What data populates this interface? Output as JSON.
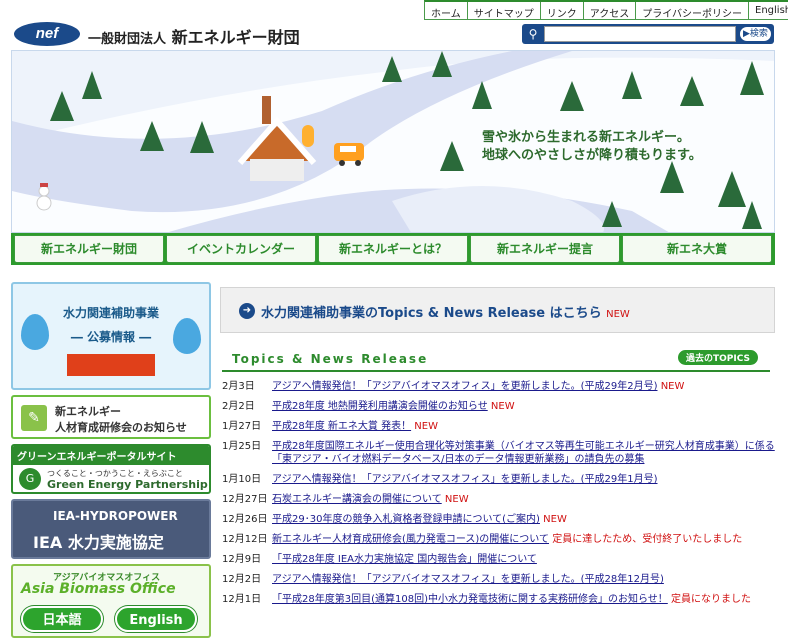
{
  "topnav": [
    "ホーム",
    "サイトマップ",
    "リンク",
    "アクセス",
    "プライバシーポリシー",
    "English"
  ],
  "logo": "nef",
  "org_prefix": "一般財団法人",
  "org_name": "新エネルギー財団",
  "search": {
    "placeholder": "",
    "button": "検索"
  },
  "hero": {
    "slogan1": "雪や氷から生まれる新エネルギー。",
    "slogan2": "地球へのやさしさが降り積もります。"
  },
  "mainnav": [
    "新エネルギー財団",
    "イベントカレンダー",
    "新エネルギーとは？",
    "新エネルギー提言",
    "新エネ大賞"
  ],
  "sidebar": {
    "hydro_title": "水力関連補助事業",
    "hydro_sub": "― 公募情報 ―",
    "training1": "新エネルギー",
    "training2": "人材育成研修会のお知らせ",
    "green_head": "グリーンエネルギーポータルサイト",
    "green_sub": "つくること・つかうこと・えらぶこと",
    "green_name": "Green Energy Partnership",
    "iea_a": "IEA-HYDROPOWER",
    "iea_b": "IEA 水力実施協定",
    "abo_a": "アジアバイオマスオフィス",
    "abo_b": "Asia Biomass Office",
    "abo_jp": "日本語",
    "abo_en": "English"
  },
  "banner": {
    "text": "水力関連補助事業のTopics & News Release はこちら",
    "new": "NEW"
  },
  "topics": {
    "title": "Topics & News Release",
    "past": "過去のTOPICS"
  },
  "news": [
    {
      "date": "2月3日",
      "text": "アジアへ情報発信！「アジアバイオマスオフィス」を更新しました。(平成29年2月号)",
      "new": "NEW",
      "extra": ""
    },
    {
      "date": "2月2日",
      "text": "平成28年度 地熱開発利用講演会開催のお知らせ",
      "new": "NEW",
      "extra": ""
    },
    {
      "date": "1月27日",
      "text": "平成28年度 新エネ大賞 発表！",
      "new": "NEW",
      "extra": ""
    },
    {
      "date": "1月25日",
      "text": "平成28年度国際エネルギー使用合理化等対策事業（バイオマス等再生可能エネルギー研究人材育成事業）に係る「東アジア・バイオ燃料データベース/日本のデータ情報更新業務」の請負先の募集",
      "new": "",
      "extra": ""
    },
    {
      "date": "1月10日",
      "text": "アジアへ情報発信！「アジアバイオマスオフィス」を更新しました。(平成29年1月号)",
      "new": "",
      "extra": ""
    },
    {
      "date": "12月27日",
      "text": "石炭エネルギー講演会の開催について",
      "new": "NEW",
      "extra": ""
    },
    {
      "date": "12月26日",
      "text": "平成29･30年度の競争入札資格者登録申請について(ご案内)",
      "new": "NEW",
      "extra": ""
    },
    {
      "date": "12月12日",
      "text": "新エネルギー人材育成研修会(風力発電コース)の開催について",
      "new": "",
      "extra": "定員に達したため、受付終了いたしました"
    },
    {
      "date": "12月9日",
      "text": "「平成28年度 IEA水力実施協定 国内報告会」開催について",
      "new": "",
      "extra": ""
    },
    {
      "date": "12月2日",
      "text": "アジアへ情報発信！「アジアバイオマスオフィス」を更新しました。(平成28年12月号)",
      "new": "",
      "extra": ""
    },
    {
      "date": "12月1日",
      "text": "「平成28年度第3回目(通算108回)中小水力発電技術に関する実務研修会」のお知らせ！",
      "new": "",
      "extra": "定員になりました"
    }
  ]
}
